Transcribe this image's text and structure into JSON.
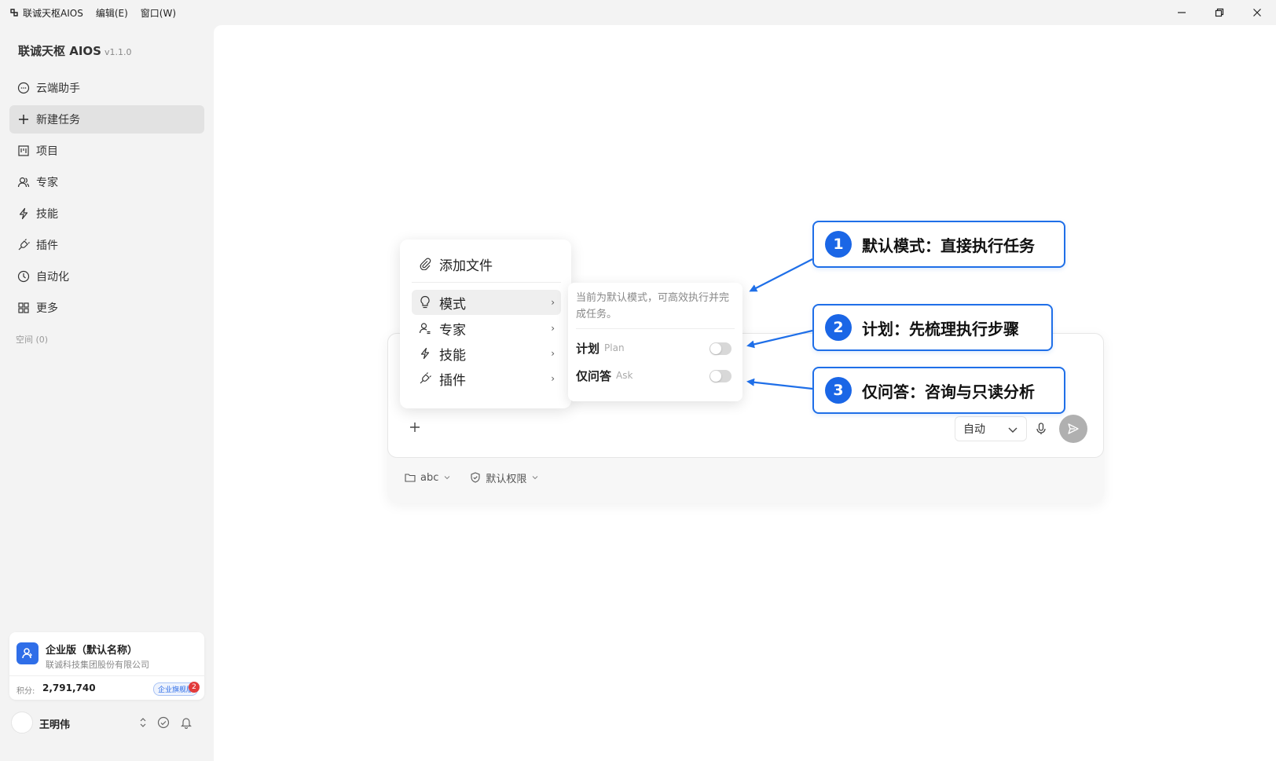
{
  "titlebar": {
    "app_name": "联诚天枢AIOS",
    "menu": [
      "编辑(E)",
      "窗口(W)"
    ]
  },
  "sidebar": {
    "brand": "联诚天枢 AIOS",
    "version": "v1.1.0",
    "items": [
      {
        "label": "云端助手",
        "icon": "chat-bubble-icon",
        "active": false
      },
      {
        "label": "新建任务",
        "icon": "plus-icon",
        "active": true
      },
      {
        "label": "项目",
        "icon": "board-icon",
        "active": false
      },
      {
        "label": "专家",
        "icon": "users-icon",
        "active": false
      },
      {
        "label": "技能",
        "icon": "lightning-icon",
        "active": false
      },
      {
        "label": "插件",
        "icon": "plug-icon",
        "active": false
      },
      {
        "label": "自动化",
        "icon": "clock-icon",
        "active": false
      },
      {
        "label": "更多",
        "icon": "grid-icon",
        "active": false
      }
    ],
    "space_label": "空间 (0)",
    "enterprise": {
      "name": "企业版（默认名称）",
      "company": "联诚科技集团股份有限公司",
      "points_label": "积分:",
      "points": "2,791,740",
      "badge": "企业旗舰版"
    },
    "user": {
      "name": "王明伟",
      "notifications": "2"
    }
  },
  "composer": {
    "mode_select": "自动",
    "folder": "abc",
    "permission": "默认权限"
  },
  "popup": {
    "add_file": "添加文件",
    "items": [
      {
        "label": "模式",
        "icon": "bulb-icon"
      },
      {
        "label": "专家",
        "icon": "expert-icon"
      },
      {
        "label": "技能",
        "icon": "lightning-icon"
      },
      {
        "label": "插件",
        "icon": "plug-icon"
      }
    ],
    "arrow": "›"
  },
  "submenu": {
    "description": "当前为默认模式，可高效执行并完成任务。",
    "options": [
      {
        "label": "计划",
        "en": "Plan",
        "enabled": false
      },
      {
        "label": "仅问答",
        "en": "Ask",
        "enabled": false
      }
    ]
  },
  "callouts": [
    {
      "num": "1",
      "text": "默认模式：直接执行任务"
    },
    {
      "num": "2",
      "text": "计划：先梳理执行步骤"
    },
    {
      "num": "3",
      "text": "仅问答：咨询与只读分析"
    }
  ],
  "colors": {
    "accent": "#1f6fe8",
    "sidebar_bg": "#f3f3f3",
    "notification": "#e23b3b"
  }
}
